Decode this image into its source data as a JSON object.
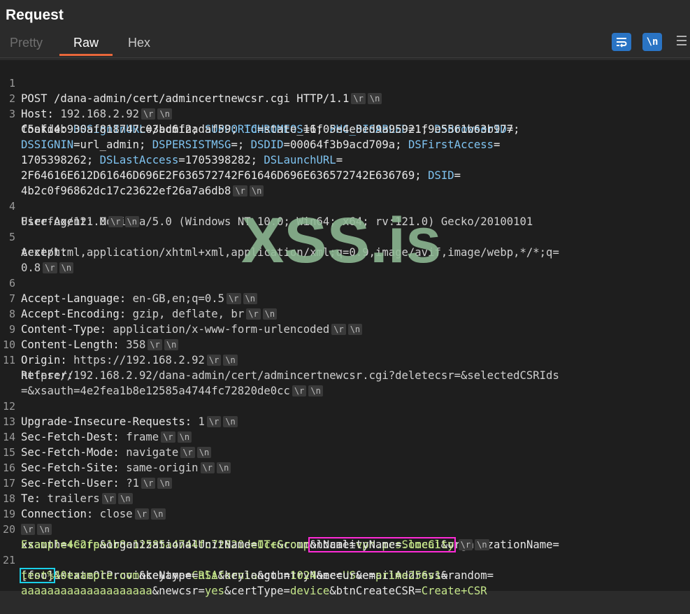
{
  "panel": {
    "title": "Request",
    "tabs": [
      {
        "label": "Pretty",
        "active": false
      },
      {
        "label": "Raw",
        "active": true
      },
      {
        "label": "Hex",
        "active": false
      }
    ],
    "toolbar": {
      "wrap_icon": "wrap-lines-icon",
      "newline_icon": "show-newlines-icon",
      "newline_label": "\\n",
      "menu_icon": "hamburger-menu-icon"
    }
  },
  "crlf": {
    "cr": "\\r",
    "lf": "\\n"
  },
  "watermark": "XSS.is",
  "request": {
    "l1": {
      "num": "1",
      "text": "POST /dana-admin/cert/admincertnewcsr.cgi HTTP/1.1"
    },
    "l2": {
      "num": "2",
      "key": "Host: ",
      "val": "192.168.2.92"
    },
    "l3": {
      "num": "3",
      "key": "Cookie: ",
      "w1": "DSSignInURL",
      "w2": "=/admin; ",
      "w3": "SUPPORTCHROMEOS",
      "w4": "=1; ",
      "w5": "PHC_DISABLED",
      "w6": "=1; ",
      "w7": "DSBrowserID",
      "w8": "=",
      "w9": "f5afd4b930af818747c03bc6f2adaf59; ",
      "w10": "id",
      "w11": "=state_16f05e4e8ed9a95921f9e5561b63b977;",
      "w12": "DSSIGNIN",
      "w13": "=url_admin; ",
      "w14": "DSPERSISTMSG",
      "w15": "=; ",
      "w16": "DSDID",
      "w17": "=00064f3b9acd709a; ",
      "w18": "DSFirstAccess",
      "w19": "=",
      "w20": "1705398262; ",
      "w21": "DSLastAccess",
      "w22": "=1705398282; ",
      "w23": "DSLaunchURL",
      "w24": "=",
      "w25": "2F64616E612D61646D696E2F636572742F61646D696E636572742E636769; ",
      "w26": "DSID",
      "w27": "=",
      "w28": "4b2c0f96862dc17c23622ef26a7a6db8"
    },
    "l4": {
      "num": "4",
      "key": "User-Agent: ",
      "val1": "Mozilla/5.0 (Windows NT 10.0; Win64; x64; rv:121.0) Gecko/20100101",
      "val2": "Firefox/121.0"
    },
    "l5": {
      "num": "5",
      "key": "Accept:",
      "val1": "text/html,application/xhtml+xml,application/xml;q=0.9,image/avif,image/webp,*/*;q=",
      "val2": "0.8"
    },
    "l6": {
      "num": "6",
      "key": "Accept-Language: ",
      "val": "en-GB,en;q=0.5"
    },
    "l7": {
      "num": "7",
      "key": "Accept-Encoding: ",
      "val": "gzip, deflate, br"
    },
    "l8": {
      "num": "8",
      "key": "Content-Type: ",
      "val": "application/x-www-form-urlencoded"
    },
    "l9": {
      "num": "9",
      "key": "Content-Length: ",
      "val": "358"
    },
    "l10": {
      "num": "10",
      "key": "Origin: ",
      "val": "https://192.168.2.92"
    },
    "l11": {
      "num": "11",
      "key": "Referer:",
      "val1": "https://192.168.2.92/dana-admin/cert/admincertnewcsr.cgi?deletecsr=&selectedCSRIds",
      "val2": "=&xsauth=4e2fea1b8e12585a4744fc72820de0cc"
    },
    "l12": {
      "num": "12",
      "key": "Upgrade-Insecure-Requests: ",
      "val": "1"
    },
    "l13": {
      "num": "13",
      "key": "Sec-Fetch-Dest: ",
      "val": "frame"
    },
    "l14": {
      "num": "14",
      "key": "Sec-Fetch-Mode: ",
      "val": "navigate"
    },
    "l15": {
      "num": "15",
      "key": "Sec-Fetch-Site: ",
      "val": "same-origin"
    },
    "l16": {
      "num": "16",
      "key": "Sec-Fetch-User: ",
      "val": "?1"
    },
    "l17": {
      "num": "17",
      "key": "Te: ",
      "val": "trailers"
    },
    "l18": {
      "num": "18",
      "key": "Connection: ",
      "val": "close"
    },
    "l19": {
      "num": "19"
    },
    "l20": {
      "num": "20",
      "b1": "xsauth",
      "b2": "=",
      "b3": "4e2fea1b8e12585a4744fc72820de0cc",
      "b4": "&commonName",
      "b5": "=",
      "b6": "vpn.pcs.local",
      "b7": "&organizationName",
      "b8": "=",
      "b9": "Example+Corp",
      "b10": "&organizationalUnitName",
      "b11": "=",
      "b12": "IT+Group",
      "b13": "&localityName",
      "b14": "=",
      "b15": "SomeCity"
    },
    "l21": {
      "num": "21",
      "c1": "[foo]",
      "c2": "&stateOrProvinceName",
      "c3": "=",
      "c4": "California",
      "c5": "&countryName",
      "c6": "=",
      "c7": "US",
      "c8": "&emailAddress",
      "c9": "=",
      "c10": "test%40example.com",
      "c11": "&keytype",
      "c12": "=",
      "c13": "RSA",
      "c14": "&keylength",
      "c15": "=",
      "c16": "1024",
      "c17": "&eccurve",
      "c18": "=",
      "c19": "prime256v1",
      "c20": "&random",
      "c21": "=",
      "c22": "aaaaaaaaaaaaaaaaaaaa",
      "c23": "&newcsr",
      "c24": "=",
      "c25": "yes",
      "c26": "&certType",
      "c27": "=",
      "c28": "device",
      "c29": "&btnCreateCSR",
      "c30": "=",
      "c31": "Create+CSR"
    }
  }
}
